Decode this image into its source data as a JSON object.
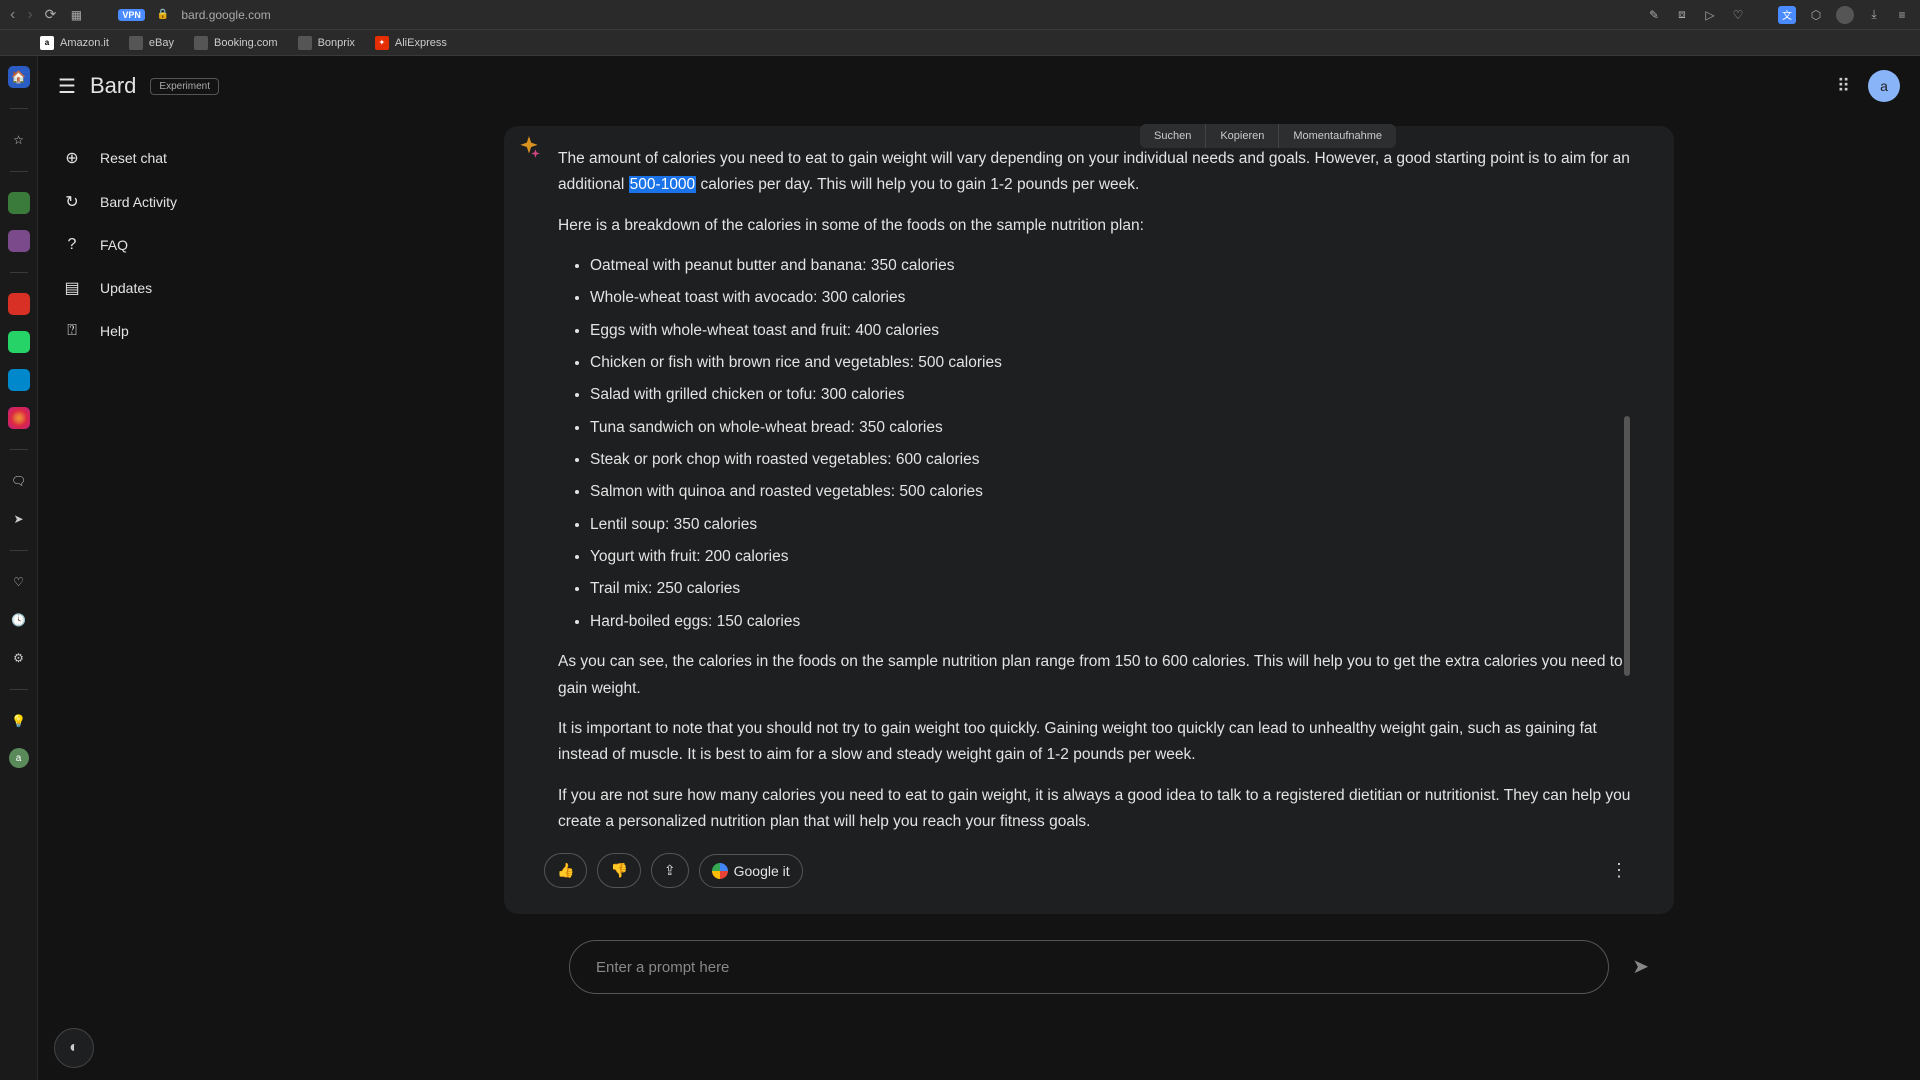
{
  "browser": {
    "vpn": "VPN",
    "url": "bard.google.com"
  },
  "bookmarks": [
    {
      "label": "Amazon.it"
    },
    {
      "label": "eBay"
    },
    {
      "label": "Booking.com"
    },
    {
      "label": "Bonprix"
    },
    {
      "label": "AliExpress"
    }
  ],
  "header": {
    "logo": "Bard",
    "badge": "Experiment",
    "avatar_letter": "a"
  },
  "sidebar": {
    "items": [
      {
        "label": "Reset chat"
      },
      {
        "label": "Bard Activity"
      },
      {
        "label": "FAQ"
      },
      {
        "label": "Updates"
      },
      {
        "label": "Help"
      }
    ]
  },
  "context_menu": {
    "search": "Suchen",
    "copy": "Kopieren",
    "snapshot": "Momentaufnahme"
  },
  "response": {
    "intro_pre": "The amount of calories you need to eat to gain weight will vary depending on your individual needs and goals. However, a good starting point is to aim for an additional ",
    "intro_highlight": "500-1000",
    "intro_post": " calories per day. This will help you to gain 1-2 pounds per week.",
    "breakdown_intro": "Here is a breakdown of the calories in some of the foods on the sample nutrition plan:",
    "foods": [
      "Oatmeal with peanut butter and banana: 350 calories",
      "Whole-wheat toast with avocado: 300 calories",
      "Eggs with whole-wheat toast and fruit: 400 calories",
      "Chicken or fish with brown rice and vegetables: 500 calories",
      "Salad with grilled chicken or tofu: 300 calories",
      "Tuna sandwich on whole-wheat bread: 350 calories",
      "Steak or pork chop with roasted vegetables: 600 calories",
      "Salmon with quinoa and roasted vegetables: 500 calories",
      "Lentil soup: 350 calories",
      "Yogurt with fruit: 200 calories",
      "Trail mix: 250 calories",
      "Hard-boiled eggs: 150 calories"
    ],
    "summary": "As you can see, the calories in the foods on the sample nutrition plan range from 150 to 600 calories. This will help you to get the extra calories you need to gain weight.",
    "note": "It is important to note that you should not try to gain weight too quickly. Gaining weight too quickly can lead to unhealthy weight gain, such as gaining fat instead of muscle. It is best to aim for a slow and steady weight gain of 1-2 pounds per week.",
    "advice": "If you are not sure how many calories you need to eat to gain weight, it is always a good idea to talk to a registered dietitian or nutritionist. They can help you create a personalized nutrition plan that will help you reach your fitness goals."
  },
  "actions": {
    "google_it": "Google it"
  },
  "prompt": {
    "placeholder": "Enter a prompt here"
  },
  "rail_avatar": "a"
}
